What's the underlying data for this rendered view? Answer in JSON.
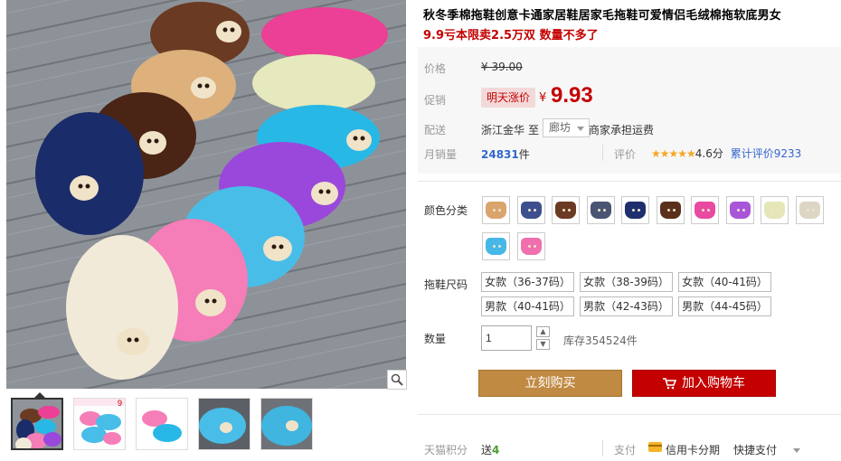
{
  "product": {
    "title": "秋冬季棉拖鞋创意卡通家居鞋居家毛拖鞋可爱情侣毛绒棉拖软底男女",
    "subtitle": "9.9亏本限卖2.5万双 数量不多了"
  },
  "price": {
    "label": "价格",
    "original": "¥ 39.00",
    "promo_label": "促销",
    "promo_badge": "明天涨价",
    "currency": "¥",
    "current": "9.93"
  },
  "shipping": {
    "label": "配送",
    "from": "浙江金华",
    "to_word": "至",
    "dest": "廊坊",
    "note": "商家承担运费"
  },
  "sales": {
    "label": "月销量",
    "count": "24831",
    "unit": "件",
    "rating_label": "评价",
    "stars": "★★★★★",
    "rating": 4.6,
    "rating_text": "4.6分",
    "reviews_text": "累计评价9233"
  },
  "color": {
    "label": "颜色分类",
    "options": [
      {
        "color": "#d9a56d",
        "icon": "slipper-tan"
      },
      {
        "color": "#3d4f8e",
        "icon": "slipper-navy"
      },
      {
        "color": "#6b3a22",
        "icon": "slipper-brown"
      },
      {
        "color": "#4a5574",
        "icon": "slipper-slate"
      },
      {
        "color": "#1e2f6e",
        "icon": "slipper-dark-blue"
      },
      {
        "color": "#5a2f1c",
        "icon": "slipper-chocolate"
      },
      {
        "color": "#e84aa2",
        "icon": "slipper-pink"
      },
      {
        "color": "#a955d8",
        "icon": "slipper-purple"
      },
      {
        "color": "#e4e6b8",
        "icon": "slipper-cream"
      },
      {
        "color": "#ddd6c4",
        "icon": "slipper-beige"
      },
      {
        "color": "#45b8e8",
        "icon": "slipper-sky-blue"
      },
      {
        "color": "#f06fae",
        "icon": "slipper-rose"
      }
    ]
  },
  "size": {
    "label": "拖鞋尺码",
    "options": [
      "女款（36-37码）",
      "女款（38-39码）",
      "女款（40-41码）",
      "男款（40-41码）",
      "男款（42-43码）",
      "男款（44-45码）"
    ]
  },
  "quantity": {
    "label": "数量",
    "value": "1",
    "stock": "库存354524件"
  },
  "actions": {
    "buy": "立刻购买",
    "cart": "加入购物车"
  },
  "footer": {
    "points_label": "天猫积分",
    "points_prefix": "送",
    "points_value": "4",
    "pay_label": "支付",
    "credit": "信用卡分期",
    "quick": "快捷支付"
  },
  "gallery": {
    "thumbs": [
      "thumb-1",
      "thumb-2",
      "thumb-3",
      "thumb-4",
      "thumb-5"
    ],
    "thumb_badge": "9"
  },
  "colors": {
    "accent_red": "#c40000",
    "buy_brown": "#c08a43",
    "link_blue": "#3366cc"
  }
}
